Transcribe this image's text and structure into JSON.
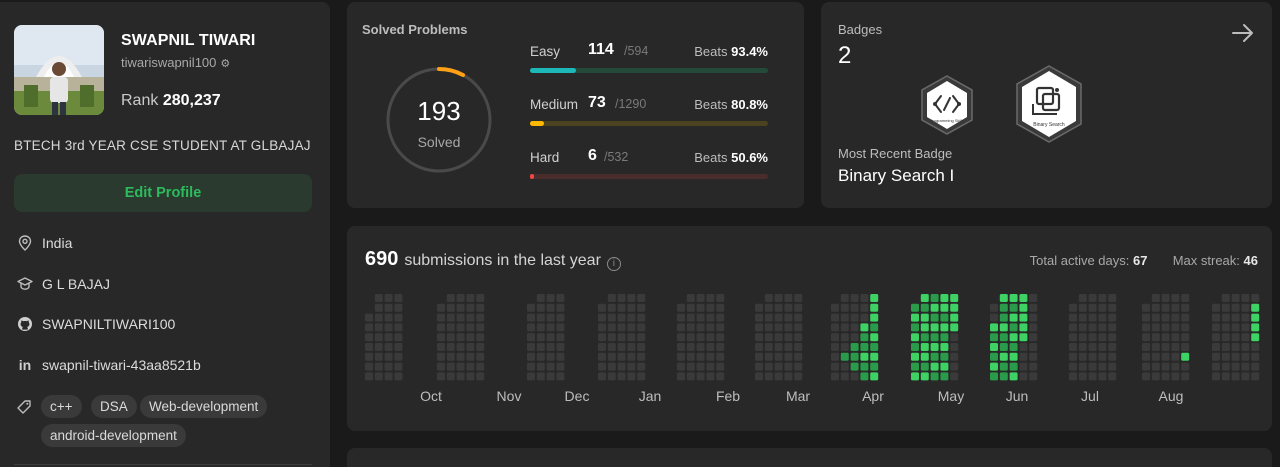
{
  "profile": {
    "name": "SWAPNIL TIWARI",
    "username": "tiwariswapnil100",
    "rank_label": "Rank",
    "rank_value": "280,237",
    "bio": "BTECH 3rd YEAR CSE STUDENT AT GLBAJAJ",
    "edit_label": "Edit Profile",
    "location": "India",
    "school": "G L BAJAJ",
    "github": "SWAPNILTIWARI100",
    "linkedin": "swapnil-tiwari-43aa8521b",
    "skills": [
      "c++",
      "DSA",
      "Web-development",
      "android-development"
    ]
  },
  "solved": {
    "title": "Solved Problems",
    "count": "193",
    "count_label": "Solved",
    "beats_label": "Beats",
    "difficulties": [
      {
        "name": "Easy",
        "solved": "114",
        "total": "/594",
        "beats": "93.4%",
        "progress": 0.192,
        "color": "#1cb8b8",
        "track": "#244a3a"
      },
      {
        "name": "Medium",
        "solved": "73",
        "total": "/1290",
        "beats": "80.8%",
        "progress": 0.057,
        "color": "#ffb800",
        "track": "#4b4220"
      },
      {
        "name": "Hard",
        "solved": "6",
        "total": "/532",
        "beats": "50.6%",
        "progress": 0.011,
        "color": "#ef4743",
        "track": "#4a2c2c"
      }
    ]
  },
  "badges": {
    "title": "Badges",
    "count": "2",
    "items": [
      {
        "name": "Programming Skills",
        "icon": "programming-skills-badge-icon"
      },
      {
        "name": "Binary Search",
        "icon": "binary-search-badge-icon"
      }
    ],
    "recent_label": "Most Recent Badge",
    "recent_value": "Binary Search I"
  },
  "heatmap": {
    "count": "690",
    "title_text": "submissions in the last year",
    "active_days_label": "Total active days:",
    "active_days": "67",
    "max_streak_label": "Max streak:",
    "max_streak": "46",
    "months": [
      "Oct",
      "Nov",
      "Dec",
      "Jan",
      "Feb",
      "Mar",
      "Apr",
      "May",
      "Jun",
      "Jul",
      "Aug"
    ],
    "colors": {
      "empty": "#3a3a3a",
      "l1": "#196c2e",
      "l2": "#2a9b4a",
      "l3": "#3ed163"
    }
  }
}
